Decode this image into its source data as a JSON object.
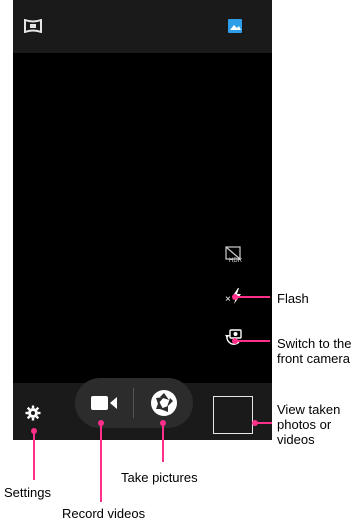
{
  "camera": {
    "top_left_icon": "panorama-icon",
    "top_right_icon": "gallery-icon",
    "right_controls": [
      "hdr-off-icon",
      "flash-off-icon",
      "switch-camera-icon"
    ],
    "bottom_icons": [
      "settings-icon",
      "video-camera-icon",
      "shutter-icon",
      "thumbnail-preview"
    ],
    "colors": {
      "accent_blue": "#2f9ee8",
      "callout_pink": "#ff2f8a"
    }
  },
  "callouts": {
    "flash": "Flash",
    "switch_camera_line1": "Switch to the",
    "switch_camera_line2": "front camera",
    "view_photos_line1": "View taken",
    "view_photos_line2": "photos or",
    "view_photos_line3": "videos",
    "take_pictures": "Take pictures",
    "settings": "Settings",
    "record_videos": "Record videos"
  }
}
